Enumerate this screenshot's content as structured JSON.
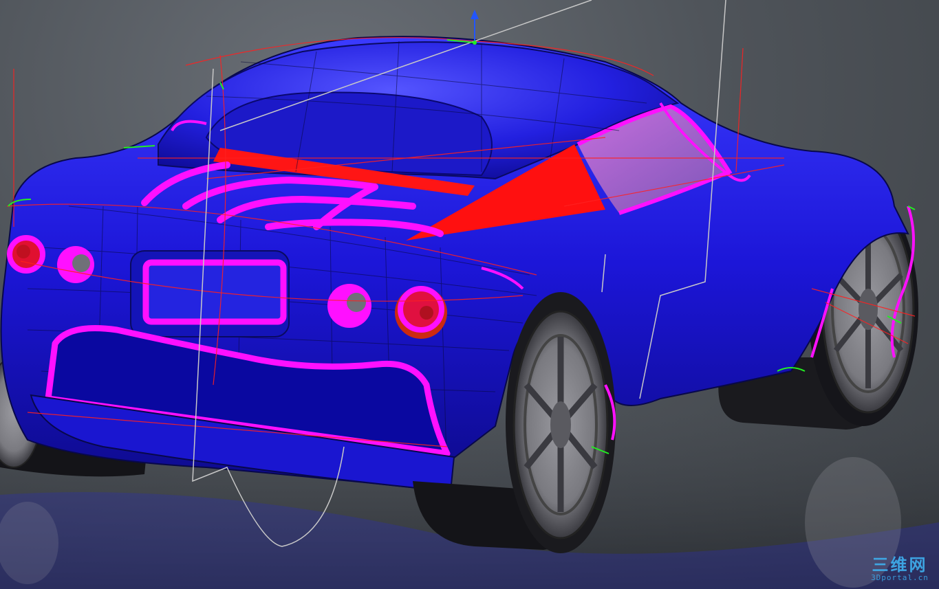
{
  "viewport": {
    "background": "#4f545a",
    "body_color": "#1a12d6",
    "body_highlight": "#3a3aff",
    "accent_curve_color": "#ff10ff",
    "construction_line_color": "#ff2020",
    "guide_line_color": "#c8c8c8",
    "handle_color": "#22ee22",
    "manipulator_color": "#2255ff"
  },
  "scene": {
    "object": "sports-car-surface-model",
    "view": "rear-three-quarter"
  },
  "watermark": {
    "main": "三维网",
    "sub": "3Dportal.cn"
  }
}
